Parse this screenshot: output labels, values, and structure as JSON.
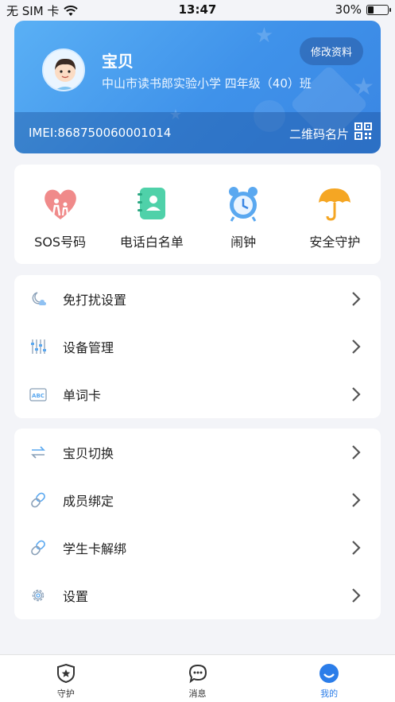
{
  "status_bar": {
    "carrier": "无 SIM 卡",
    "time": "13:47",
    "battery_percent": "30%",
    "battery_level": 0.3
  },
  "profile": {
    "name": "宝贝",
    "school": "中山市读书郎实验小学 四年级（40）班",
    "edit_label": "修改资料",
    "imei": "IMEI:868750060001014",
    "qr_label": "二维码名片"
  },
  "quick_actions": [
    {
      "label": "SOS号码",
      "icon": "sos-heart-icon"
    },
    {
      "label": "电话白名单",
      "icon": "phonebook-icon"
    },
    {
      "label": "闹钟",
      "icon": "alarm-clock-icon"
    },
    {
      "label": "安全守护",
      "icon": "umbrella-icon"
    }
  ],
  "settings_group_1": [
    {
      "label": "免打扰设置",
      "icon": "moon-cloud-icon"
    },
    {
      "label": "设备管理",
      "icon": "sliders-icon"
    },
    {
      "label": "单词卡",
      "icon": "abc-card-icon"
    }
  ],
  "settings_group_2": [
    {
      "label": "宝贝切换",
      "icon": "switch-arrows-icon"
    },
    {
      "label": "成员绑定",
      "icon": "link-icon"
    },
    {
      "label": "学生卡解绑",
      "icon": "link-icon"
    },
    {
      "label": "设置",
      "icon": "gear-icon"
    }
  ],
  "tab_bar": [
    {
      "label": "守护",
      "icon": "shield-star-icon"
    },
    {
      "label": "消息",
      "icon": "chat-bubble-icon"
    },
    {
      "label": "我的",
      "icon": "profile-face-icon",
      "active": true
    }
  ],
  "colors": {
    "accent": "#2b7de9",
    "card_gradient_start": "#5ab0f5",
    "card_gradient_end": "#3a86e3",
    "background": "#f3f4f8"
  }
}
